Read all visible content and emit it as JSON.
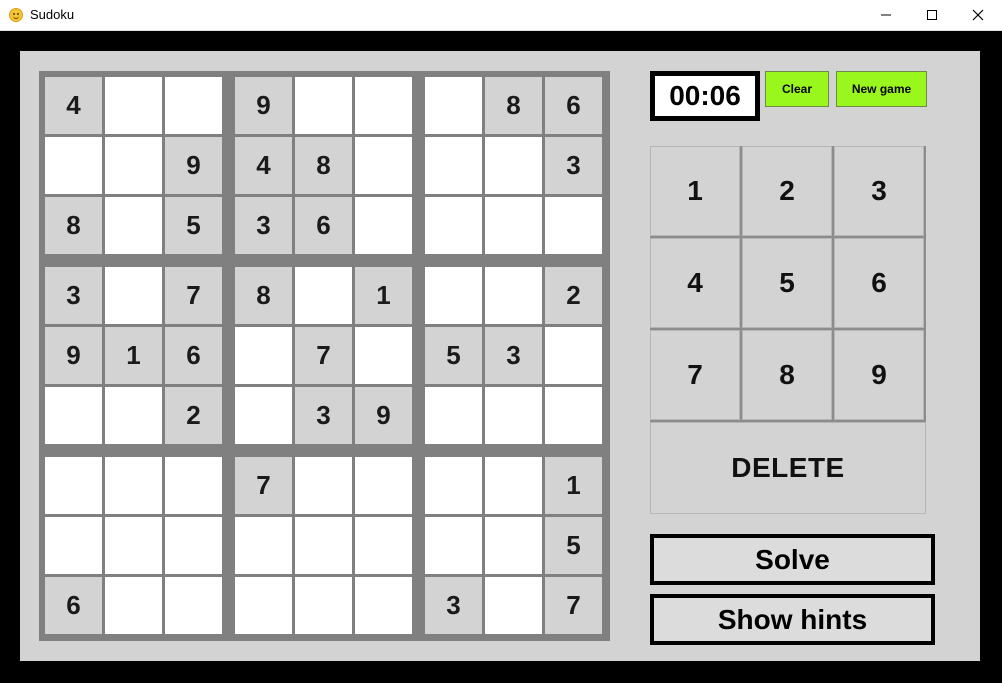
{
  "window": {
    "title": "Sudoku"
  },
  "timer": "00:06",
  "buttons": {
    "clear": "Clear",
    "new_game": "New game",
    "solve": "Solve",
    "hints": "Show hints",
    "delete": "DELETE"
  },
  "numpad": [
    "1",
    "2",
    "3",
    "4",
    "5",
    "6",
    "7",
    "8",
    "9"
  ],
  "board": [
    [
      "4",
      "",
      "",
      "9",
      "",
      "",
      "",
      "8",
      "6"
    ],
    [
      "",
      "",
      "9",
      "4",
      "8",
      "",
      "",
      "",
      "3"
    ],
    [
      "8",
      "",
      "5",
      "3",
      "6",
      "",
      "",
      "",
      ""
    ],
    [
      "3",
      "",
      "7",
      "8",
      "",
      "1",
      "",
      "",
      "2"
    ],
    [
      "9",
      "1",
      "6",
      "",
      "7",
      "",
      "5",
      "3",
      ""
    ],
    [
      "",
      "",
      "2",
      "",
      "3",
      "9",
      "",
      "",
      ""
    ],
    [
      "",
      "",
      "",
      "7",
      "",
      "",
      "",
      "",
      "1"
    ],
    [
      "",
      "",
      "",
      "",
      "",
      "",
      "",
      "",
      "5"
    ],
    [
      "6",
      "",
      "",
      "",
      "",
      "",
      "3",
      "",
      "7"
    ]
  ]
}
